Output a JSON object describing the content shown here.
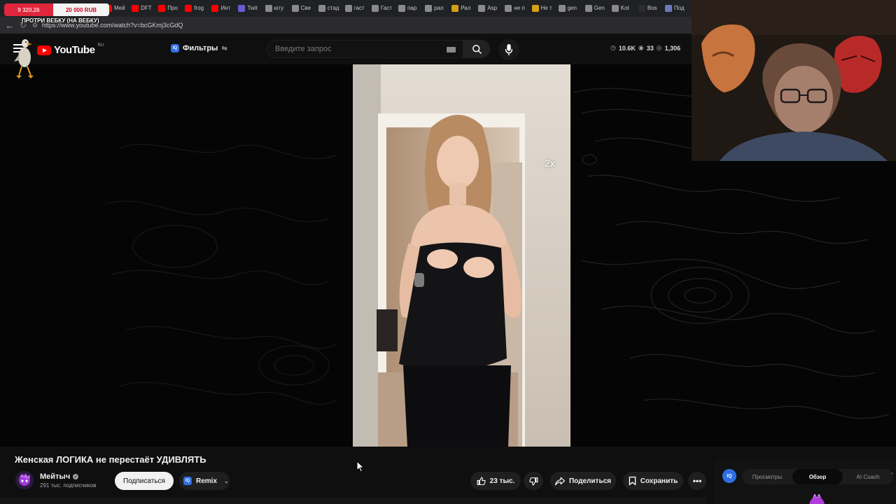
{
  "browser": {
    "donation": {
      "amount": "9 320.26",
      "goal": "20 000 RUB"
    },
    "overlay_label": "ПРОТРИ ВЕБКУ (НА ВЕБКУ)",
    "url": "https://www.youtube.com/watch?v=bcGKmj3cGdQ",
    "tabs": [
      {
        "label": "Мей",
        "color": "#ff0000"
      },
      {
        "label": "DFT",
        "color": "#ff0000"
      },
      {
        "label": "Про",
        "color": "#ff0000"
      },
      {
        "label": "frog",
        "color": "#ff0000"
      },
      {
        "label": "Инт",
        "color": "#ff0000"
      },
      {
        "label": "Twit",
        "color": "#6a5acd"
      },
      {
        "label": "юту",
        "color": "#8a8a8a"
      },
      {
        "label": "Све",
        "color": "#8a8a8a"
      },
      {
        "label": "стад",
        "color": "#8a8a8a"
      },
      {
        "label": "гаст",
        "color": "#8a8a8a"
      },
      {
        "label": "Гаст",
        "color": "#8a8a8a"
      },
      {
        "label": "пар",
        "color": "#8a8a8a"
      },
      {
        "label": "рал",
        "color": "#8a8a8a"
      },
      {
        "label": "Рал",
        "color": "#d4a017"
      },
      {
        "label": "Asp",
        "color": "#8a8a8a"
      },
      {
        "label": "не п",
        "color": "#8a8a8a"
      },
      {
        "label": "Не т",
        "color": "#d4a017"
      },
      {
        "label": "gen",
        "color": "#8a8a8a"
      },
      {
        "label": "Gen",
        "color": "#8a8a8a"
      },
      {
        "label": "Kot",
        "color": "#8a8a8a"
      },
      {
        "label": "Bos",
        "color": "#2d2d2d"
      },
      {
        "label": "Под",
        "color": "#6c7ab8"
      }
    ]
  },
  "header": {
    "logo_text": "YouTube",
    "region": "RU",
    "filters_label": "Фильтры",
    "iq_badge": "IQ",
    "search_placeholder": "Введите запрос",
    "stats": {
      "views": "10.6K",
      "watching": "33",
      "other": "1,306"
    }
  },
  "player": {
    "speed": "2x"
  },
  "video": {
    "title": "Женская ЛОГИКА не перестаёт УДИВЛЯТЬ",
    "channel": "Мейтыч",
    "subscribers": "291 тыс. подписчиков",
    "subscribe_label": "Подписаться",
    "remix_label": "Remix",
    "likes": "23 тыс.",
    "share_label": "Поделиться",
    "save_label": "Сохранить"
  },
  "panel": {
    "badge": "IQ",
    "tabs": [
      "Просмотры",
      "Обзор",
      "AI Coach"
    ],
    "active_tab": "Обзор"
  },
  "colors": {
    "accent_red": "#ff0000",
    "iq_blue": "#2f6fe4",
    "donation_red": "#e0263c",
    "background": "#0f0f0f"
  }
}
